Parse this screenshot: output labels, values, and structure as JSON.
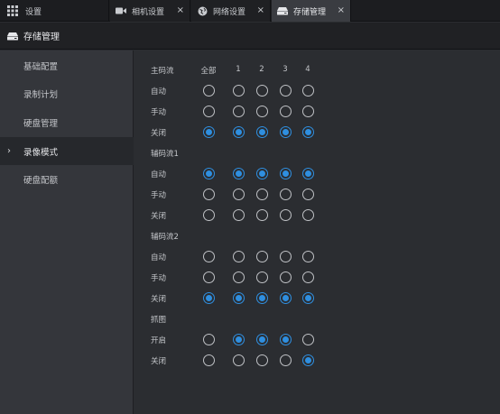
{
  "tabs": {
    "home": {
      "label": "设置",
      "icon": "grid-icon"
    },
    "camera": {
      "label": "相机设置",
      "icon": "camera-icon",
      "close": "×"
    },
    "network": {
      "label": "网络设置",
      "icon": "globe-icon",
      "close": "×"
    },
    "storage": {
      "label": "存储管理",
      "icon": "storage-icon",
      "close": "×"
    }
  },
  "header": {
    "title": "存储管理",
    "icon": "storage-icon"
  },
  "sidebar": {
    "items": [
      {
        "label": "基础配置"
      },
      {
        "label": "录制计划"
      },
      {
        "label": "硬盘管理"
      },
      {
        "label": "录像模式",
        "active": true,
        "arrow": "›"
      },
      {
        "label": "硬盘配额"
      }
    ]
  },
  "columns": [
    "全部",
    "1",
    "2",
    "3",
    "4"
  ],
  "sections": [
    {
      "title": "主码流",
      "rows": [
        {
          "label": "自动",
          "values": [
            false,
            false,
            false,
            false,
            false
          ]
        },
        {
          "label": "手动",
          "values": [
            false,
            false,
            false,
            false,
            false
          ]
        },
        {
          "label": "关闭",
          "values": [
            true,
            true,
            true,
            true,
            true
          ]
        }
      ]
    },
    {
      "title": "辅码流1",
      "rows": [
        {
          "label": "自动",
          "values": [
            true,
            true,
            true,
            true,
            true
          ]
        },
        {
          "label": "手动",
          "values": [
            false,
            false,
            false,
            false,
            false
          ]
        },
        {
          "label": "关闭",
          "values": [
            false,
            false,
            false,
            false,
            false
          ]
        }
      ]
    },
    {
      "title": "辅码流2",
      "rows": [
        {
          "label": "自动",
          "values": [
            false,
            false,
            false,
            false,
            false
          ]
        },
        {
          "label": "手动",
          "values": [
            false,
            false,
            false,
            false,
            false
          ]
        },
        {
          "label": "关闭",
          "values": [
            true,
            true,
            true,
            true,
            true
          ]
        }
      ]
    },
    {
      "title": "抓图",
      "rows": [
        {
          "label": "开启",
          "values": [
            false,
            true,
            true,
            true,
            false
          ]
        },
        {
          "label": "关闭",
          "values": [
            false,
            false,
            false,
            false,
            true
          ]
        }
      ]
    }
  ],
  "colors": {
    "accent": "#2f8fe0",
    "sidebar": "#34363b",
    "background": "#2b2d31"
  }
}
